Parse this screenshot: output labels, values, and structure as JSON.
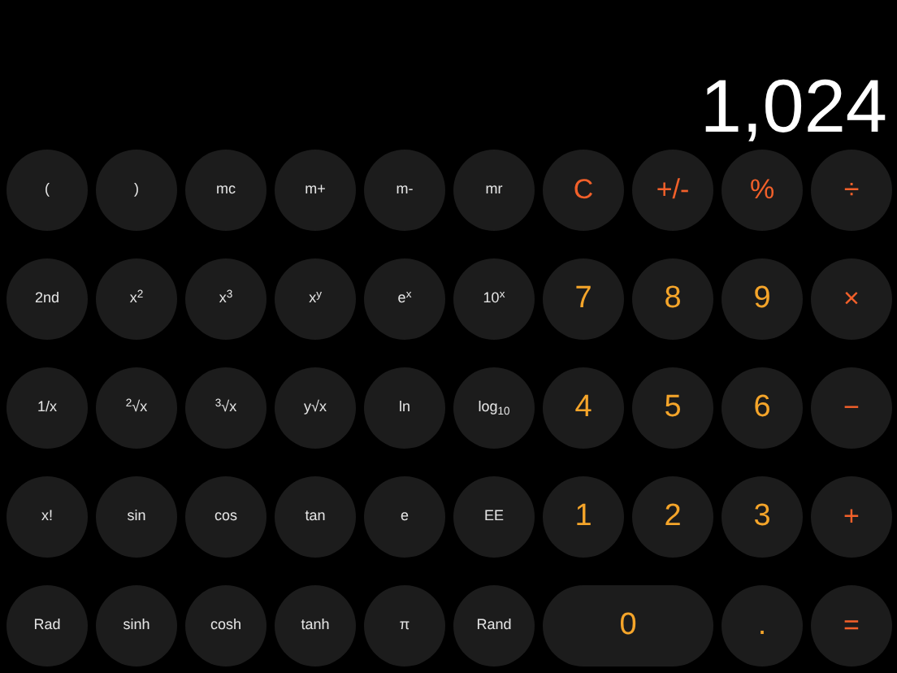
{
  "display": {
    "value": "1,024"
  },
  "keypad": [
    [
      {
        "label": "(",
        "kind": "function"
      },
      {
        "label": ")",
        "kind": "function"
      },
      {
        "label": "mc",
        "kind": "function"
      },
      {
        "label": "m+",
        "kind": "function"
      },
      {
        "label": "m-",
        "kind": "function"
      },
      {
        "label": "mr",
        "kind": "function"
      },
      {
        "label": "C",
        "kind": "operator"
      },
      {
        "label": "+/-",
        "kind": "operator"
      },
      {
        "label": "%",
        "kind": "operator"
      },
      {
        "label": "÷",
        "kind": "operator"
      }
    ],
    [
      {
        "label": "2nd",
        "kind": "function"
      },
      {
        "label": "x$^{2}$",
        "kind": "function"
      },
      {
        "label": "x$^{3}$",
        "kind": "function"
      },
      {
        "label": "x$^{y}$",
        "kind": "function"
      },
      {
        "label": "e$^{x}$",
        "kind": "function"
      },
      {
        "label": "10$^{x}$",
        "kind": "function"
      },
      {
        "label": "7",
        "kind": "digit"
      },
      {
        "label": "8",
        "kind": "digit"
      },
      {
        "label": "9",
        "kind": "digit"
      },
      {
        "label": "×",
        "kind": "operator"
      }
    ],
    [
      {
        "label": "1/x",
        "kind": "function"
      },
      {
        "label": "$^{2}$√x",
        "kind": "function"
      },
      {
        "label": "$^{3}$√x",
        "kind": "function"
      },
      {
        "label": "y√x",
        "kind": "function"
      },
      {
        "label": "ln",
        "kind": "function"
      },
      {
        "label": "log$_{10}$",
        "kind": "function"
      },
      {
        "label": "4",
        "kind": "digit"
      },
      {
        "label": "5",
        "kind": "digit"
      },
      {
        "label": "6",
        "kind": "digit"
      },
      {
        "label": "−",
        "kind": "operator"
      }
    ],
    [
      {
        "label": "x!",
        "kind": "function"
      },
      {
        "label": "sin",
        "kind": "function"
      },
      {
        "label": "cos",
        "kind": "function"
      },
      {
        "label": "tan",
        "kind": "function"
      },
      {
        "label": "e",
        "kind": "function"
      },
      {
        "label": "EE",
        "kind": "function"
      },
      {
        "label": "1",
        "kind": "digit"
      },
      {
        "label": "2",
        "kind": "digit"
      },
      {
        "label": "3",
        "kind": "digit"
      },
      {
        "label": "+",
        "kind": "operator"
      }
    ],
    [
      {
        "label": "Rad",
        "kind": "function"
      },
      {
        "label": "sinh",
        "kind": "function"
      },
      {
        "label": "cosh",
        "kind": "function"
      },
      {
        "label": "tanh",
        "kind": "function"
      },
      {
        "label": "π",
        "kind": "function"
      },
      {
        "label": "Rand",
        "kind": "function"
      },
      {
        "label": "0",
        "kind": "wide_digit"
      },
      {
        "label": ".",
        "kind": "digit"
      },
      {
        "label": "=",
        "kind": "operator"
      }
    ]
  ]
}
